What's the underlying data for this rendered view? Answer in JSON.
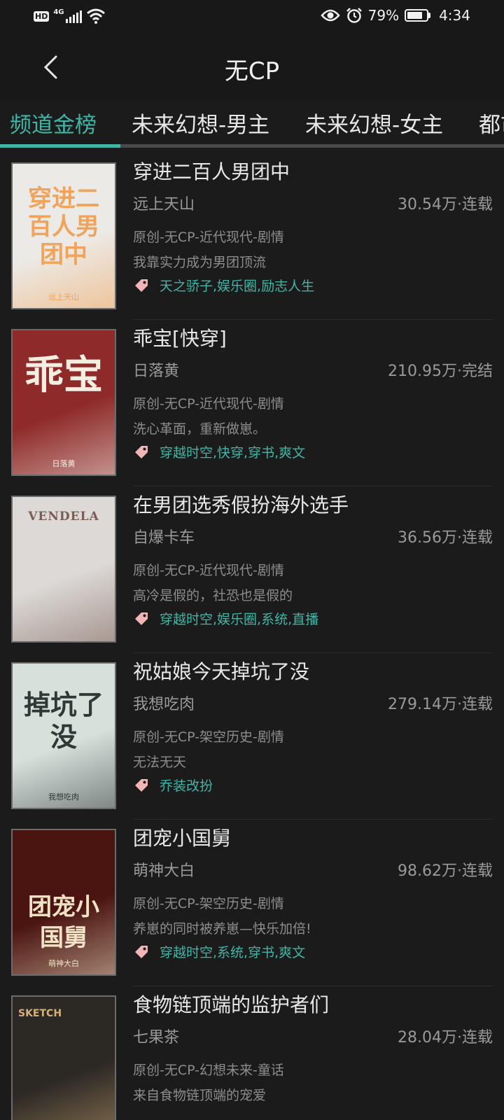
{
  "status_bar": {
    "hd": "HD",
    "network": "4G",
    "battery_percent": "79%",
    "battery_level": 0.79,
    "time": "4:34"
  },
  "header": {
    "title": "无CP",
    "back_icon": "chevron-left-icon"
  },
  "tabs": [
    {
      "label": "频道金榜",
      "active": true
    },
    {
      "label": "未来幻想-男主",
      "active": false
    },
    {
      "label": "未来幻想-女主",
      "active": false
    },
    {
      "label": "都市",
      "active": false
    }
  ],
  "colors": {
    "accent": "#3fb6a6",
    "background": "#1b1b1b",
    "tag_icon": "#f3b6b6"
  },
  "books": [
    {
      "title": "穿进二百人男团中",
      "author": "远上天山",
      "stats": "30.54万·连载",
      "category": "原创-无CP-近代现代-剧情",
      "description": "我靠实力成为男团顶流",
      "tags": "天之骄子,娱乐圈,励志人生",
      "cover_title": "穿进二百人男团中",
      "cover_author": "远上天山",
      "cover_colors": [
        "#eceae6",
        "#f0a35a"
      ]
    },
    {
      "title": "乖宝[快穿]",
      "author": "日落黄",
      "stats": "210.95万·完结",
      "category": "原创-无CP-近代现代-剧情",
      "description": "洗心革面，重新做崽。",
      "tags": "穿越时空,快穿,穿书,爽文",
      "cover_title": "乖宝",
      "cover_author": "日落黄",
      "cover_colors": [
        "#8e2a2a",
        "#f3ede2"
      ]
    },
    {
      "title": "在男团选秀假扮海外选手",
      "author": "自爆卡车",
      "stats": "36.56万·连载",
      "category": "原创-无CP-近代现代-剧情",
      "description": "高冷是假的，社恐也是假的",
      "tags": "穿越时空,娱乐圈,系统,直播",
      "cover_title": "VENDELA",
      "cover_author": "",
      "cover_colors": [
        "#dcd9d6",
        "#7a5e54"
      ]
    },
    {
      "title": "祝姑娘今天掉坑了没",
      "author": "我想吃肉",
      "stats": "279.14万·连载",
      "category": "原创-无CP-架空历史-剧情",
      "description": "无法无天",
      "tags": "乔装改扮",
      "cover_title": "掉坑了没",
      "cover_author": "我想吃肉",
      "cover_colors": [
        "#d8e0dc",
        "#2f3a36"
      ]
    },
    {
      "title": "团宠小国舅",
      "author": "萌神大白",
      "stats": "98.62万·连载",
      "category": "原创-无CP-架空历史-剧情",
      "description": "养崽的同时被养崽—快乐加倍!",
      "tags": "穿越时空,系统,穿书,爽文",
      "cover_title": "团宠小国舅",
      "cover_author": "萌神大白",
      "cover_colors": [
        "#4a1410",
        "#f1e3c6"
      ]
    },
    {
      "title": "食物链顶端的监护者们",
      "author": "七果茶",
      "stats": "28.04万·连载",
      "category": "原创-无CP-幻想未来-童话",
      "description": "来自食物链顶端的宠爱",
      "tags": "",
      "cover_title": "SKETCH",
      "cover_author": "",
      "cover_colors": [
        "#2c2824",
        "#d7b07a"
      ]
    }
  ]
}
